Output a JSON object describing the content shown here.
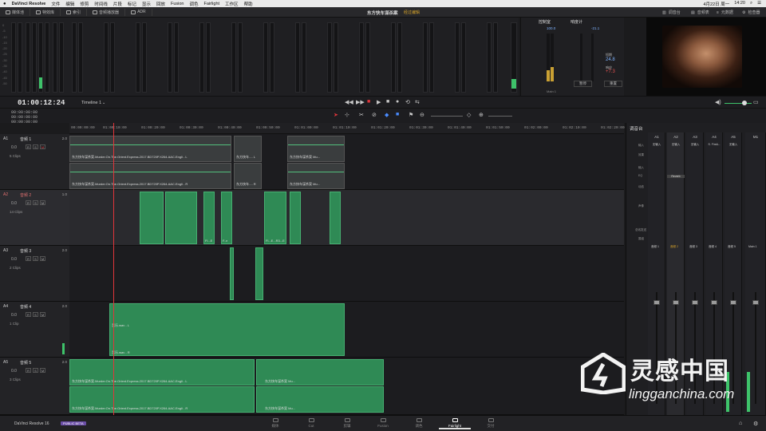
{
  "menubar": {
    "app": "DaVinci Resolve",
    "items": [
      "文件",
      "编辑",
      "修剪",
      "时间线",
      "片段",
      "标记",
      "显示",
      "回放",
      "Fusion",
      "调色",
      "Fairlight",
      "工作区",
      "帮助"
    ],
    "date": "4月22日 周一",
    "time": "14:20"
  },
  "toolbar": {
    "items": [
      "媒体池",
      "特效库",
      "索引",
      "音频播放器",
      "ADR"
    ],
    "project_title": "东方快车谋杀案",
    "edited": "经过编辑",
    "right_items": [
      "调音台",
      "音频表",
      "元数据",
      "检查器"
    ]
  },
  "loudness": {
    "title1": "控制室",
    "title2": "响度计",
    "val1": "100.0",
    "val2": "-21.1",
    "label_short": "短期",
    "short_val": "24.8",
    "label_range": "响应",
    "range_val": "+7.3",
    "btn_pause": "暂停",
    "btn_reset": "重置",
    "main1": "Main 1"
  },
  "timecode": "01:00:12:24",
  "timeline_name": "Timeline 1",
  "tc_rows": [
    "00:00:00:00",
    "00:00:00:00",
    "00:00:00:00"
  ],
  "ruler": [
    "00:00:00:00",
    "01:00:10:00",
    "01:00:20:00",
    "01:00:30:00",
    "01:00:40:00",
    "01:00:50:00",
    "01:01:00:00",
    "01:01:10:00",
    "01:01:20:00",
    "01:01:30:00",
    "01:01:40:00",
    "01:01:50:00",
    "01:02:00:00",
    "01:02:10:00",
    "01:02:20:00"
  ],
  "tracks": [
    {
      "id": "A1",
      "name": "音频 1",
      "vol": "0.0",
      "ch": "2.0",
      "clips": "5 Clips",
      "clip_labels": [
        "东方快车谋杀案.Murder.On.The.Orient.Express.2017.BD720P.X264.AAC.Engli - L",
        "东方快车谋杀案.Murder.On.The.Orient.Express.2017.BD720P.X264.AAC.Engli - R",
        "东方快车...- L",
        "东方快车...- R",
        "东方快车谋杀案 Mu...",
        "东方快车谋杀案 Mu..."
      ]
    },
    {
      "id": "A2",
      "name": "音频 2",
      "vol": "0.0",
      "ch": "1.0",
      "clips": "14 Clips",
      "clip_labels": [
        "Fl...E",
        "F..e",
        "Fl...E...R3...E"
      ]
    },
    {
      "id": "A3",
      "name": "音频 3",
      "vol": "0.0",
      "ch": "2.0",
      "clips": "2 Clips",
      "clip_labels": []
    },
    {
      "id": "A4",
      "name": "音频 4",
      "vol": "0.0",
      "ch": "2.0",
      "clips": "1 Clip",
      "clip_labels": [
        "音乐.wav - L",
        "音乐.wav - R"
      ]
    },
    {
      "id": "A5",
      "name": "音频 5",
      "vol": "0.0",
      "ch": "2.0",
      "clips": "3 Clips",
      "clip_labels": [
        "东方快车谋杀案.Murder.On.The.Orient.Express.2017.BD720P.X264.AAC.Engli - L",
        "东方快车谋杀案 Mu...",
        "东方快车谋杀案.Murder.On.The.Orient.Express.2017.BD720P.X264.AAC.Engli - R",
        "东方快车谋杀案 Mu..."
      ]
    }
  ],
  "mixer": {
    "title": "调音台",
    "cols": [
      "A1",
      "A2",
      "A3",
      "A4",
      "A5",
      "M1"
    ],
    "inputs": [
      "无输入",
      "无输入",
      "无输入",
      "S. FirstL..",
      "无输入"
    ],
    "row_labels": [
      "输入",
      "效果",
      "输入",
      "EQ",
      "动态",
      "声像",
      "总线发送",
      "属组"
    ],
    "effect": "Reverb",
    "strips": [
      "音频 1",
      "音频 2",
      "音频 3",
      "音频 4",
      "音频 5",
      "Main 1"
    ]
  },
  "pages": [
    "媒体",
    "Cut",
    "剪辑",
    "Fusion",
    "调色",
    "Fairlight",
    "交付"
  ],
  "active_page": "Fairlight",
  "bottom": {
    "app": "DaVinci Resolve 16",
    "badge": "PUBLIC BETA"
  },
  "watermark": {
    "cn": "灵感中国",
    "en": "lingganchina.com"
  },
  "colors": {
    "accent": "#d8a42a",
    "clip_green": "#2f8a55",
    "playhead": "#e0353a"
  }
}
